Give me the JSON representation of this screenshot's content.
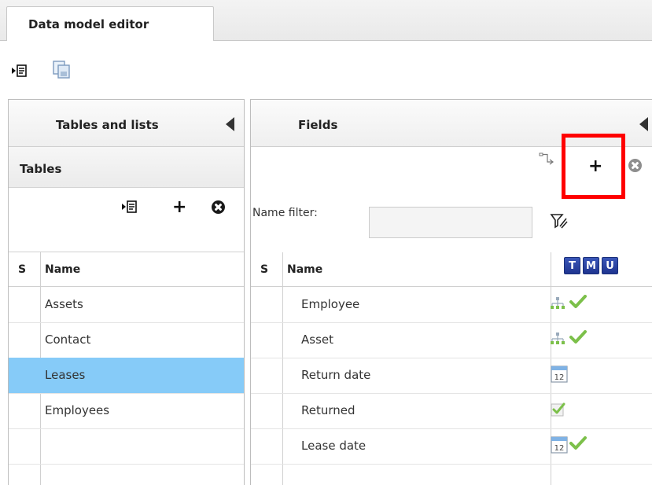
{
  "tab": {
    "title": "Data model editor"
  },
  "toolbar": {
    "export_icon": "export-icon",
    "copy_icon": "copy-icon"
  },
  "left_panel": {
    "title": "Tables and lists",
    "subtitle": "Tables",
    "headers": {
      "s": "S",
      "name": "Name"
    },
    "items": [
      {
        "name": "Assets",
        "selected": false
      },
      {
        "name": "Contact",
        "selected": false
      },
      {
        "name": "Leases",
        "selected": true
      },
      {
        "name": "Employees",
        "selected": false
      }
    ]
  },
  "right_panel": {
    "title": "Fields",
    "filter": {
      "label": "Name filter:",
      "value": "",
      "placeholder": ""
    },
    "headers": {
      "s": "S",
      "name": "Name",
      "t": "T",
      "m": "M",
      "u": "U"
    },
    "fields": [
      {
        "name": "Employee",
        "icons": [
          "hierarchy-icon",
          "checkmark-icon"
        ]
      },
      {
        "name": "Asset",
        "icons": [
          "hierarchy-icon",
          "checkmark-icon"
        ]
      },
      {
        "name": "Return date",
        "icons": [
          "calendar-icon"
        ]
      },
      {
        "name": "Returned",
        "icons": [
          "checkbox-checked-icon"
        ]
      },
      {
        "name": "Lease date",
        "icons": [
          "calendar-icon",
          "checkmark-icon"
        ]
      }
    ]
  },
  "calendar_day": "12",
  "colors": {
    "selected_row": "#86cbf8",
    "highlight": "#ff0000",
    "badge": "#2a44a8",
    "check": "#7cc04a"
  }
}
